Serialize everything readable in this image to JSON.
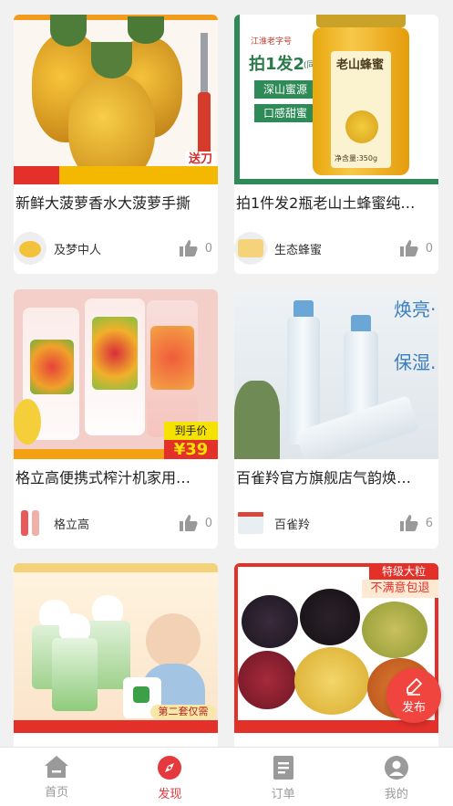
{
  "feed": {
    "items": [
      {
        "title": "新鲜大菠萝香水大菠萝手撕",
        "shop": "及梦中人",
        "likes": "0",
        "image": "pineapple-photo",
        "badge": "送刀"
      },
      {
        "title": "拍1件发2瓶老山土蜂蜜纯…",
        "shop": "生态蜂蜜",
        "likes": "0",
        "image": "honey-jar-photo",
        "brand": "江淮老字号",
        "promo": "拍1发2",
        "promo_sub": "(同款)",
        "tag1": "深山蜜源",
        "tag2": "口感甜蜜",
        "jar_label": "老山蜂蜜",
        "net": "净含量:350g"
      },
      {
        "title": "格立高便携式榨汁机家用…",
        "shop": "格立高",
        "likes": "0",
        "image": "juicer-photo",
        "price_label": "到手价",
        "price": "¥39"
      },
      {
        "title": "百雀羚官方旗舰店气韵焕…",
        "shop": "百雀羚",
        "likes": "6",
        "image": "skincare-photo",
        "slogan1": "焕亮·",
        "slogan2": "保湿."
      },
      {
        "title": "",
        "shop": "",
        "likes": "",
        "image": "mosquito-repellent-photo",
        "tag": "第二套仅需"
      },
      {
        "title": "",
        "shop": "",
        "likes": "",
        "image": "raisins-photo",
        "top_label": "特级大粒",
        "guarantee": "不满意包退"
      }
    ]
  },
  "fab": {
    "label": "发布",
    "icon": "pen-icon"
  },
  "tabbar": {
    "tabs": [
      {
        "label": "首页",
        "icon": "home-icon"
      },
      {
        "label": "发现",
        "icon": "compass-icon",
        "active": true
      },
      {
        "label": "订单",
        "icon": "document-icon"
      },
      {
        "label": "我的",
        "icon": "user-icon"
      }
    ]
  },
  "colors": {
    "accent": "#e5393d",
    "inactive": "#9a9a9a",
    "background": "#f1f1f1"
  }
}
